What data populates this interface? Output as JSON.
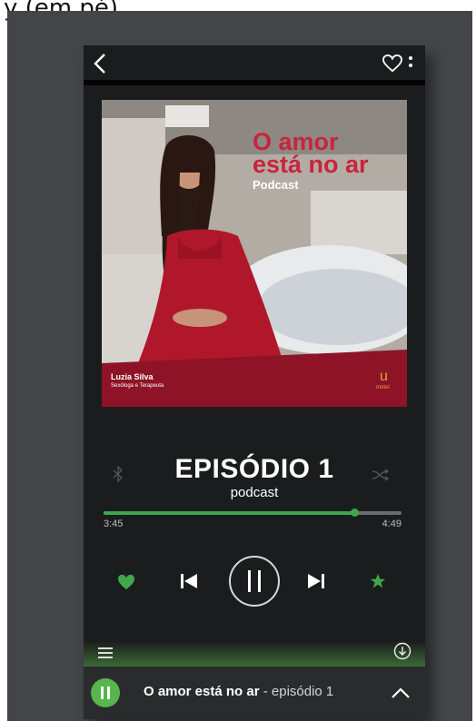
{
  "caption": "y (em pé)",
  "episode": {
    "title": "EPISÓDIO 1",
    "subtitle": "podcast"
  },
  "cover": {
    "title_line1": "O amor",
    "title_line2": "está no ar",
    "title_sub": "Podcast",
    "host_name": "Luzia Silva",
    "host_role": "Sexóloga e Terapeuta",
    "brand_letter": "u",
    "brand_name": "motel"
  },
  "progress": {
    "current": "3:45",
    "total": "4:49",
    "fraction": 0.84
  },
  "mini_player": {
    "title": "O amor está no ar",
    "separator": " - ",
    "episode": "episódio 1"
  },
  "colors": {
    "accent_green": "#3ea84a",
    "cover_red": "#c9243d",
    "background": "#1b1c1d"
  },
  "icons": {
    "back": "chevron-left-icon",
    "favorite": "heart-outline-icon",
    "menu": "kebab-menu-icon",
    "bluetooth": "bluetooth-icon",
    "shuffle": "shuffle-icon",
    "like": "heart-filled-icon",
    "previous": "skip-previous-icon",
    "pause": "pause-icon",
    "next": "skip-next-icon",
    "star": "star-icon",
    "queue": "queue-list-icon",
    "download": "download-icon",
    "expand": "chevron-up-icon"
  }
}
